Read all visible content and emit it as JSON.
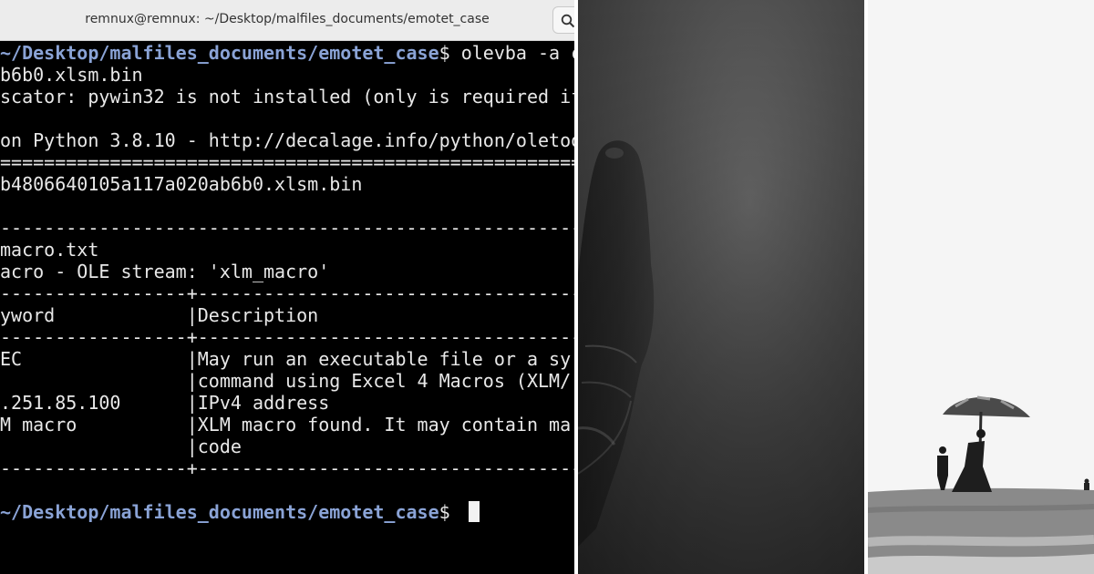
{
  "terminal": {
    "window_title": "remnux@remnux: ~/Desktop/malfiles_documents/emotet_case",
    "lines": [
      {
        "path": "~/Desktop/malfiles_documents/emotet_case",
        "text": "$ olevba -a c"
      },
      {
        "path": "",
        "text": "b6b0.xlsm.bin"
      },
      {
        "path": "",
        "text": "scator: pywin32 is not installed (only is required if"
      },
      {
        "path": "",
        "text": ""
      },
      {
        "path": "",
        "text": "on Python 3.8.10 - http://decalage.info/python/oletoo"
      },
      {
        "path": "",
        "text": "================================================================"
      },
      {
        "path": "",
        "text": "b4806640105a117a020ab6b0.xlsm.bin"
      },
      {
        "path": "",
        "text": ""
      },
      {
        "path": "",
        "text": "----------------------------------------------------------------"
      },
      {
        "path": "",
        "text": "macro.txt"
      },
      {
        "path": "",
        "text": "acro - OLE stream: 'xlm_macro'"
      },
      {
        "path": "",
        "text": "-----------------+----------------------------------------------"
      },
      {
        "path": "",
        "text": "yword            |Description"
      },
      {
        "path": "",
        "text": "-----------------+----------------------------------------------"
      },
      {
        "path": "",
        "text": "EC               |May run an executable file or a sy"
      },
      {
        "path": "",
        "text": "                 |command using Excel 4 Macros (XLM/"
      },
      {
        "path": "",
        "text": ".251.85.100      |IPv4 address"
      },
      {
        "path": "",
        "text": "M macro          |XLM macro found. It may contain ma"
      },
      {
        "path": "",
        "text": "                 |code"
      },
      {
        "path": "",
        "text": "-----------------+----------------------------------------------"
      },
      {
        "path": "",
        "text": ""
      },
      {
        "path": "~/Desktop/malfiles_documents/emotet_case",
        "text": "$ "
      }
    ]
  },
  "icons": {
    "search": "search-icon",
    "cursor": "terminal-cursor"
  },
  "colors": {
    "terminal_bg": "#000000",
    "terminal_text": "#e8e8e8",
    "prompt_path": "#8aa3d6",
    "titlebar_bg": "#ececec"
  }
}
